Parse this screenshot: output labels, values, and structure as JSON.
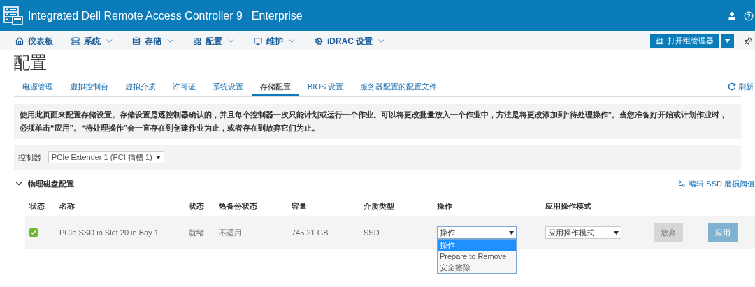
{
  "header": {
    "title": "Integrated Dell Remote Access Controller 9",
    "edition": "Enterprise"
  },
  "nav": [
    {
      "label": "仪表板",
      "has_menu": false
    },
    {
      "label": "系统",
      "has_menu": true
    },
    {
      "label": "存储",
      "has_menu": true
    },
    {
      "label": "配置",
      "has_menu": true
    },
    {
      "label": "维护",
      "has_menu": true
    },
    {
      "label": "iDRAC 设置",
      "has_menu": true
    }
  ],
  "group_manager_button": "打开组管理器",
  "page_title": "配置",
  "tabs": [
    {
      "label": "电源管理",
      "selected": false
    },
    {
      "label": "虚拟控制台",
      "selected": false
    },
    {
      "label": "虚拟介质",
      "selected": false
    },
    {
      "label": "许可证",
      "selected": false
    },
    {
      "label": "系统设置",
      "selected": false
    },
    {
      "label": "存储配置",
      "selected": true
    },
    {
      "label": "BIOS 设置",
      "selected": false
    },
    {
      "label": "服务器配置的配置文件",
      "selected": false
    }
  ],
  "refresh": "刷新",
  "description": "使用此页面来配置存储设置。存储设置是逐控制器确认的，并且每个控制器一次只能计划或运行一个作业。可以将更改批量放入一个作业中，方法是将更改添加到“待处理操作”。当您准备好开始或计划作业时，必须单击“应用”。“待处理操作”会一直存在到创建作业为止，或者存在到放弃它们为止。",
  "controller": {
    "label": "控制器",
    "value": "PCIe Extender 1 (PCI 插槽 1)"
  },
  "section": {
    "title": "物理磁盘配置",
    "expanded": true,
    "link": "编辑 SSD 磨损阈值"
  },
  "table": {
    "columns": [
      "状态",
      "名称",
      "状态",
      "热备份状态",
      "容量",
      "介质类型",
      "操作",
      "应用操作模式"
    ],
    "rows": [
      {
        "healthy": true,
        "name": "PCIe SSD in Slot 20 in Bay 1",
        "state": "就绪",
        "hotspare": "不适用",
        "capacity": "745.21 GB",
        "media": "SSD",
        "action": {
          "value": "操作",
          "expanded": true,
          "options": [
            {
              "label": "操作",
              "selected": true
            },
            {
              "label": "Prepare to Remove",
              "selected": false
            },
            {
              "label": "安全擦除",
              "selected": false
            }
          ]
        },
        "mode": {
          "value": "应用操作模式"
        },
        "buttons": [
          {
            "label": "放弃",
            "kind": "secondary",
            "disabled": true
          },
          {
            "label": "应用",
            "kind": "primary",
            "disabled": true
          }
        ]
      }
    ]
  }
}
